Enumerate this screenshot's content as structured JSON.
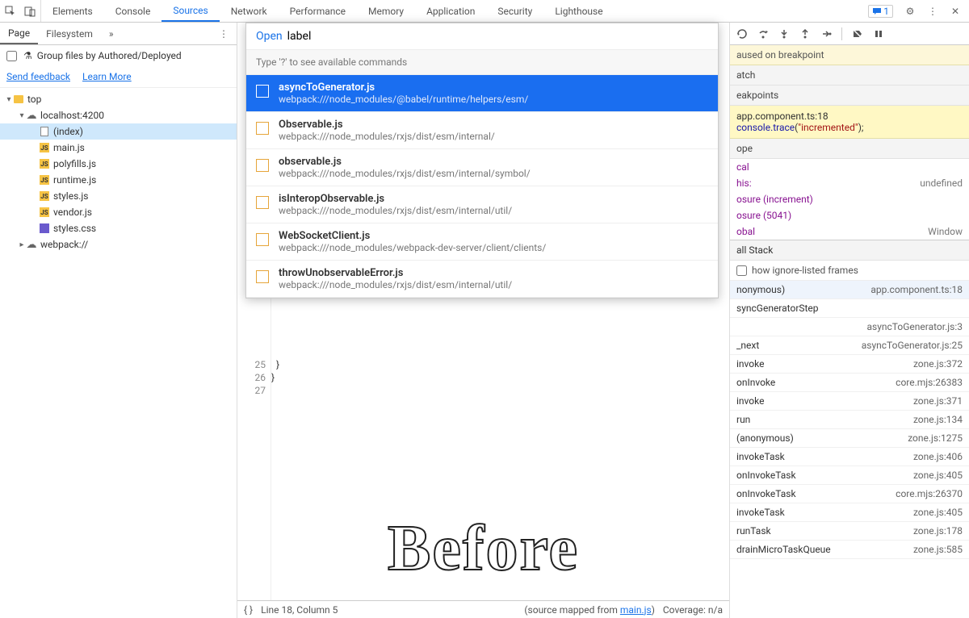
{
  "topTabs": [
    "Elements",
    "Console",
    "Sources",
    "Network",
    "Performance",
    "Memory",
    "Application",
    "Security",
    "Lighthouse"
  ],
  "activeTopTab": "Sources",
  "msgCount": "1",
  "pageTabs": [
    "Page",
    "Filesystem"
  ],
  "activePageTab": "Page",
  "groupFiles": "Group files by Authored/Deployed",
  "sendFeedback": "Send feedback",
  "learnMore": "Learn More",
  "tree": [
    {
      "depth": 0,
      "caret": "▾",
      "icon": "folder",
      "label": "top"
    },
    {
      "depth": 1,
      "caret": "▾",
      "icon": "cloud",
      "label": "localhost:4200"
    },
    {
      "depth": 2,
      "caret": "",
      "icon": "doc",
      "label": "(index)",
      "selected": true
    },
    {
      "depth": 2,
      "caret": "",
      "icon": "js",
      "label": "main.js"
    },
    {
      "depth": 2,
      "caret": "",
      "icon": "js",
      "label": "polyfills.js"
    },
    {
      "depth": 2,
      "caret": "",
      "icon": "js",
      "label": "runtime.js"
    },
    {
      "depth": 2,
      "caret": "",
      "icon": "js",
      "label": "styles.js"
    },
    {
      "depth": 2,
      "caret": "",
      "icon": "js",
      "label": "vendor.js"
    },
    {
      "depth": 2,
      "caret": "",
      "icon": "css",
      "label": "styles.css"
    },
    {
      "depth": 1,
      "caret": "▸",
      "icon": "cloud",
      "label": "webpack://"
    }
  ],
  "cmd": {
    "openLabel": "Open",
    "query": "label",
    "hint": "Type '?' to see available commands",
    "items": [
      {
        "title": "asyncToGenerator.js",
        "path": "webpack:///node_modules/@babel/runtime/helpers/esm/",
        "sel": true
      },
      {
        "title": "Observable.js",
        "path": "webpack:///node_modules/rxjs/dist/esm/internal/"
      },
      {
        "title": "observable.js",
        "path": "webpack:///node_modules/rxjs/dist/esm/internal/symbol/"
      },
      {
        "title": "isInteropObservable.js",
        "path": "webpack:///node_modules/rxjs/dist/esm/internal/util/"
      },
      {
        "title": "WebSocketClient.js",
        "path": "webpack:///node_modules/webpack-dev-server/client/clients/"
      },
      {
        "title": "throwUnobservableError.js",
        "path": "webpack:///node_modules/rxjs/dist/esm/internal/util/"
      }
    ]
  },
  "gutter": [
    "25",
    "26",
    "27"
  ],
  "codeLines": [
    "  }",
    "}",
    ""
  ],
  "overlayText": "Before",
  "status": {
    "cursor": "Line 18, Column 5",
    "mapped": "(source mapped from ",
    "mappedFile": "main.js",
    "mappedEnd": ")",
    "coverage": "Coverage: n/a"
  },
  "paused": "aused on breakpoint",
  "sections": {
    "watch": "atch",
    "breakpoints": "eakpoints",
    "scope": "ope",
    "callstack": "all Stack"
  },
  "bp": {
    "file": "app.component.ts:18",
    "fn": "console.trace",
    "paren1": "(",
    "str": "\"incremented\"",
    "paren2": ");"
  },
  "scope": [
    {
      "k": "cal",
      "v": ""
    },
    {
      "k": "his:",
      "v": "undefined"
    },
    {
      "k": "osure (increment)",
      "v": ""
    },
    {
      "k": "osure (5041)",
      "v": ""
    },
    {
      "k": "obal",
      "v": "Window"
    }
  ],
  "ignoreListed": "how ignore-listed frames",
  "stack": [
    {
      "fn": "nonymous)",
      "loc": "app.component.ts:18",
      "sel": true
    },
    {
      "fn": "syncGeneratorStep",
      "loc": ""
    },
    {
      "fn": "",
      "loc": "asyncToGenerator.js:3"
    },
    {
      "fn": "_next",
      "loc": "asyncToGenerator.js:25"
    },
    {
      "fn": "invoke",
      "loc": "zone.js:372"
    },
    {
      "fn": "onInvoke",
      "loc": "core.mjs:26383"
    },
    {
      "fn": "invoke",
      "loc": "zone.js:371"
    },
    {
      "fn": "run",
      "loc": "zone.js:134"
    },
    {
      "fn": "(anonymous)",
      "loc": "zone.js:1275"
    },
    {
      "fn": "invokeTask",
      "loc": "zone.js:406"
    },
    {
      "fn": "onInvokeTask",
      "loc": "zone.js:405"
    },
    {
      "fn": "onInvokeTask",
      "loc": "core.mjs:26370"
    },
    {
      "fn": "invokeTask",
      "loc": "zone.js:405"
    },
    {
      "fn": "runTask",
      "loc": "zone.js:178"
    },
    {
      "fn": "drainMicroTaskQueue",
      "loc": "zone.js:585"
    }
  ]
}
